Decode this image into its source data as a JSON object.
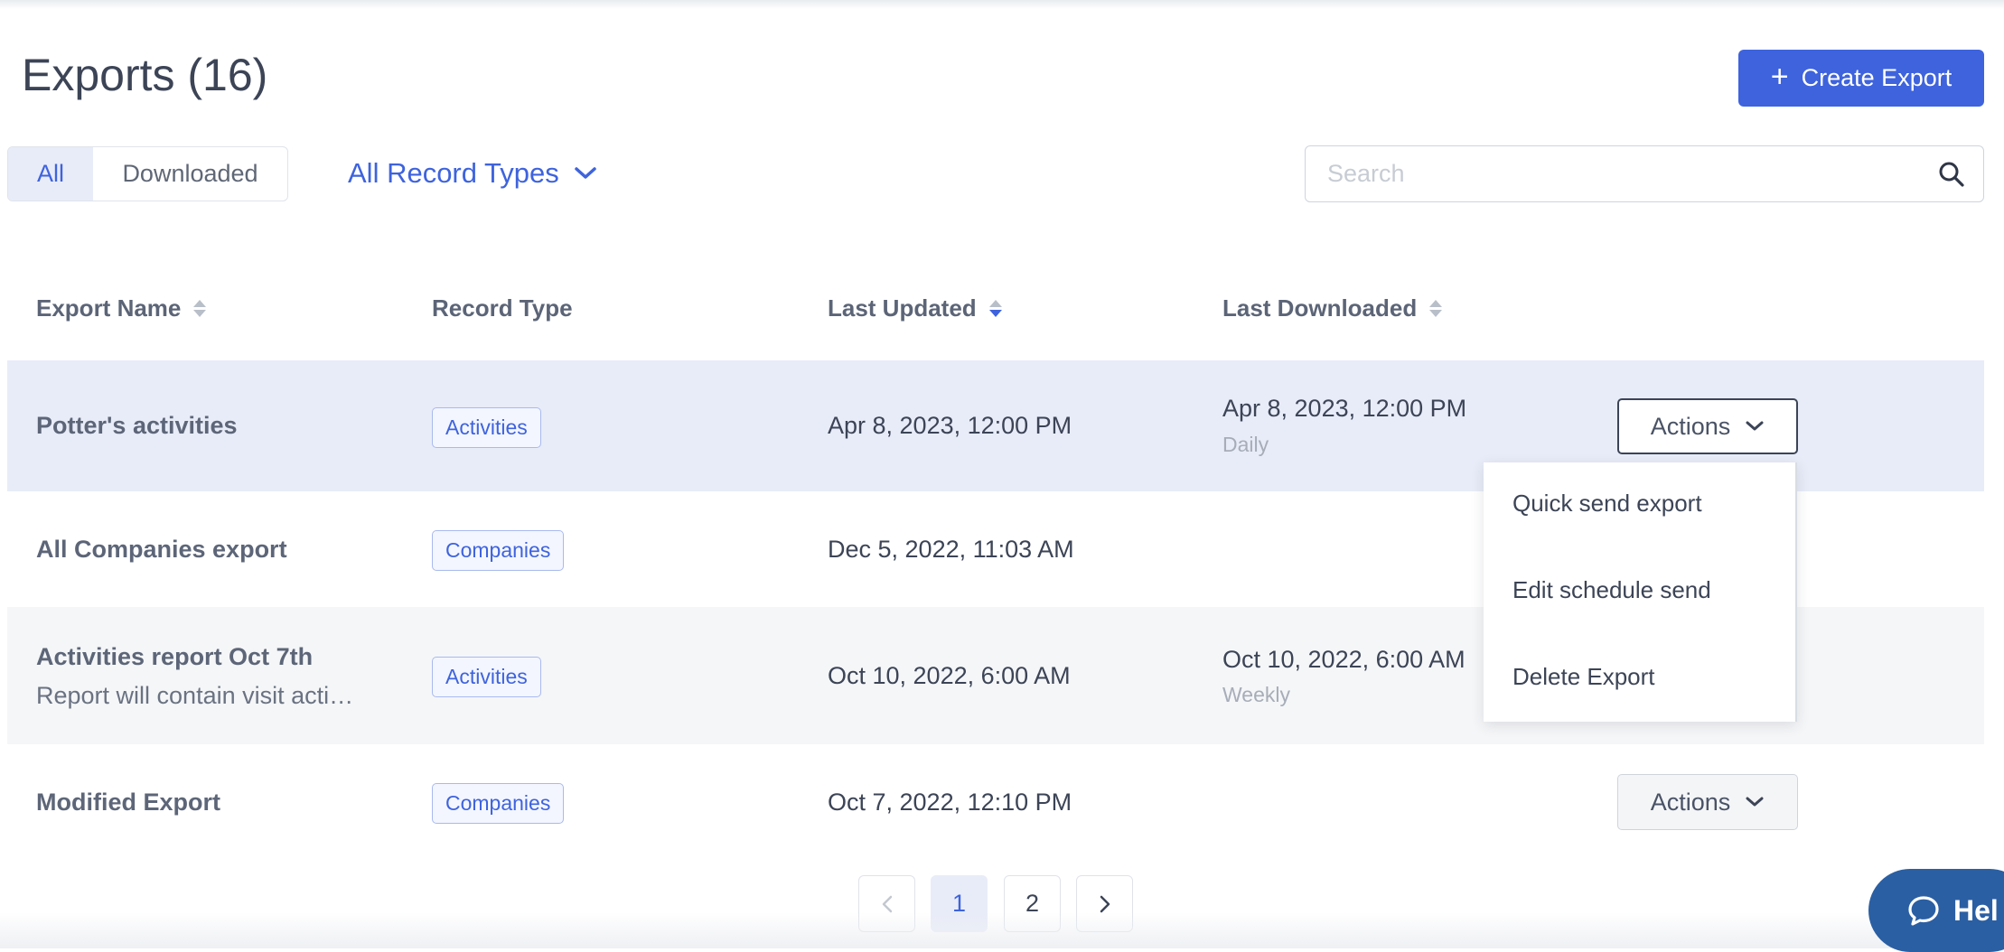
{
  "header": {
    "title": "Exports (16)",
    "create_label": "Create Export"
  },
  "filters": {
    "tab_all": "All",
    "tab_downloaded": "Downloaded",
    "record_types_label": "All Record Types",
    "search_placeholder": "Search"
  },
  "table": {
    "columns": [
      "Export Name",
      "Record Type",
      "Last Updated",
      "Last Downloaded"
    ],
    "rows": [
      {
        "name": "Potter's activities",
        "description": "",
        "record_type": "Activities",
        "last_updated": "Apr 8, 2023, 12:00 PM",
        "last_downloaded": "Apr 8, 2023, 12:00 PM",
        "frequency": "Daily",
        "actions_label": "Actions"
      },
      {
        "name": "All Companies export",
        "description": "",
        "record_type": "Companies",
        "last_updated": "Dec 5, 2022, 11:03 AM",
        "last_downloaded": "",
        "frequency": "",
        "actions_label": "Actions"
      },
      {
        "name": "Activities report Oct 7th",
        "description": "Report will contain visit acti…",
        "record_type": "Activities",
        "last_updated": "Oct 10, 2022, 6:00 AM",
        "last_downloaded": "Oct 10, 2022, 6:00 AM",
        "frequency": "Weekly",
        "actions_label": "Actions"
      },
      {
        "name": "Modified Export",
        "description": "",
        "record_type": "Companies",
        "last_updated": "Oct 7, 2022, 12:10 PM",
        "last_downloaded": "",
        "frequency": "",
        "actions_label": "Actions"
      }
    ]
  },
  "actions_menu": {
    "items": [
      "Quick send export",
      "Edit schedule send",
      "Delete Export"
    ]
  },
  "pagination": {
    "pages": [
      "1",
      "2"
    ],
    "current": "1"
  },
  "help": {
    "label": "Hel"
  },
  "colors": {
    "accent": "#3e63dd",
    "selected_row": "#e8ecf8",
    "help_bubble": "#2b5fa3"
  }
}
